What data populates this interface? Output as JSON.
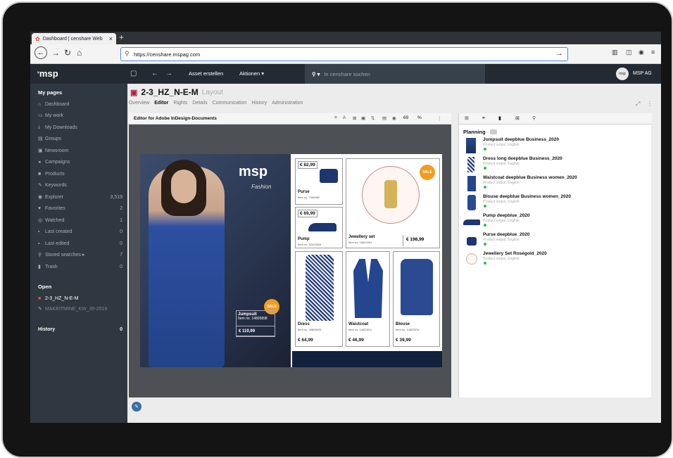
{
  "browser": {
    "tab_title": "Dashboard | censhare Web",
    "url": "https://censhare.mspag.com"
  },
  "header": {
    "logo": "msp",
    "create_asset": "Asset erstellen",
    "actions": "Aktionen ▾",
    "search_placeholder": "In censhare suchen",
    "user": "MSP AG",
    "avatar": "msp"
  },
  "sidebar": {
    "my_pages": "My pages",
    "items": [
      {
        "label": "Dashboard",
        "icon": "home-icon",
        "count": ""
      },
      {
        "label": "My work",
        "icon": "inbox-icon",
        "count": ""
      },
      {
        "label": "My Downloads",
        "icon": "download-icon",
        "count": ""
      },
      {
        "label": "Groups",
        "icon": "groups-icon",
        "count": ""
      },
      {
        "label": "Newsroom",
        "icon": "newsroom-icon",
        "count": ""
      },
      {
        "label": "Campaigns",
        "icon": "campaign-icon",
        "count": ""
      },
      {
        "label": "Products",
        "icon": "products-icon",
        "count": ""
      },
      {
        "label": "Keywords",
        "icon": "keyword-icon",
        "count": ""
      },
      {
        "label": "Explorer",
        "icon": "explorer-icon",
        "count": "3,519"
      },
      {
        "label": "Favorites",
        "icon": "heart-icon",
        "count": "2"
      },
      {
        "label": "Watched",
        "icon": "eye-icon",
        "count": "1"
      },
      {
        "label": "Last created",
        "icon": "created-icon",
        "count": "0"
      },
      {
        "label": "Last edited",
        "icon": "edited-icon",
        "count": "0"
      },
      {
        "label": "Stored searches ▸",
        "icon": "search-icon",
        "count": "7"
      },
      {
        "label": "Trash",
        "icon": "trash-icon",
        "count": "0"
      }
    ],
    "open_title": "Open",
    "open_items": [
      "2-3_HZ_N-E-M",
      "MAKEITMINE_KW_30-2019"
    ],
    "history_title": "History",
    "history_count": "0"
  },
  "asset": {
    "title": "2-3_HZ_N-E-M",
    "type": "Layout",
    "tabs": [
      "Overview",
      "Editor",
      "Rights",
      "Details",
      "Communication",
      "History",
      "Administration"
    ],
    "active_tab": "Editor"
  },
  "editor": {
    "title": "Editor for Adobe InDesign-Documents",
    "zoom": "69",
    "zoom_unit": "%"
  },
  "layout": {
    "brand": "msp",
    "brand_sub": "Fashion",
    "sale": "SALE",
    "jumpsuit": {
      "name": "Jumpsuit",
      "no": "Item no. 14805898",
      "price": "€ 119,99"
    },
    "products": [
      {
        "name": "Purse",
        "no": "Item no. 7454582",
        "price": "€ 82,99"
      },
      {
        "name": "Jewellery set",
        "no": "Item no. 15624391",
        "price": "€ 198,99"
      },
      {
        "name": "Pump",
        "no": "Item no. 52422816",
        "price": "€ 69,99"
      },
      {
        "name": "Dress",
        "no": "Item no. 26805925",
        "price": "€ 64,99"
      },
      {
        "name": "Waistcoat",
        "no": "Item no. 14820911",
        "price": "€ 46,99"
      },
      {
        "name": "Blouse",
        "no": "Item no. 14820576",
        "price": "€ 39,99"
      }
    ]
  },
  "planning": {
    "title": "Planning",
    "items": [
      {
        "name": "Jumpsuit deepblue Business_2020",
        "sub": "Product output, English"
      },
      {
        "name": "Dress long deepblue Business_2020",
        "sub": "Product output, English"
      },
      {
        "name": "Waistcoat deepblue Business women_2020",
        "sub": "Product output, English"
      },
      {
        "name": "Blouse deepblue Business women_2020",
        "sub": "Product output, English"
      },
      {
        "name": "Pump deepblue_2020",
        "sub": "Product output, English"
      },
      {
        "name": "Purse deepblue_2020",
        "sub": "Product output, English"
      },
      {
        "name": "Jewellery Set Roségold_2020",
        "sub": "Product output, English"
      }
    ]
  }
}
